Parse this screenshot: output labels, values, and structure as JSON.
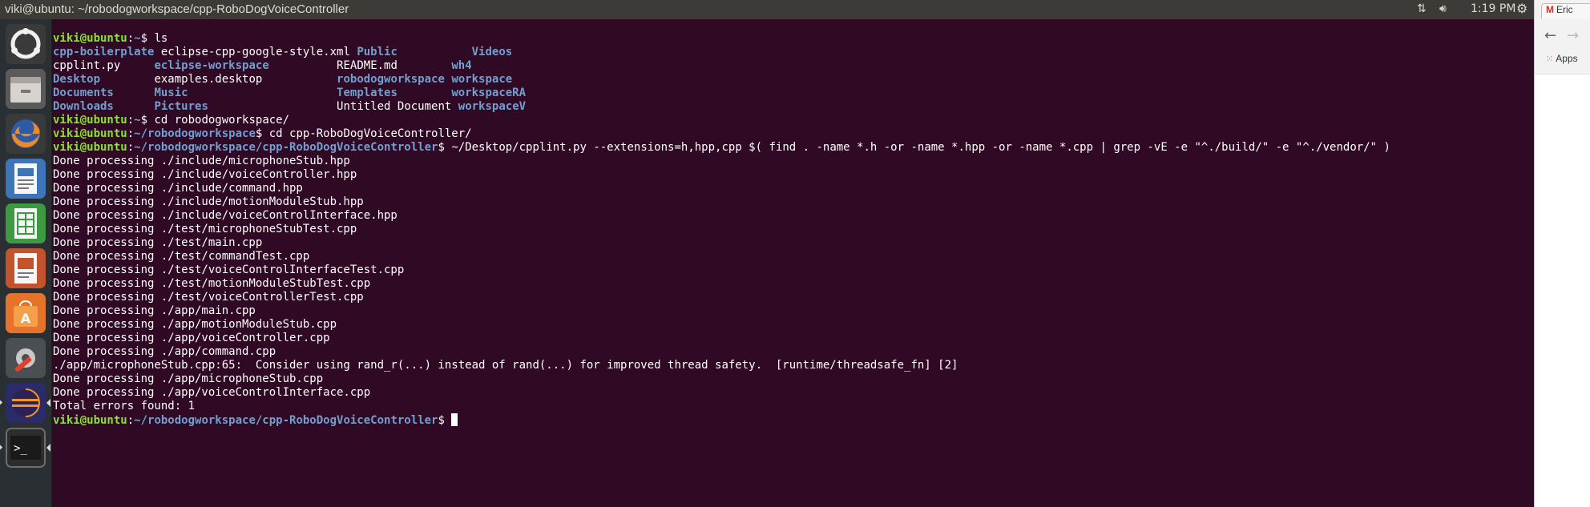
{
  "window": {
    "title": "viki@ubuntu: ~/robodogworkspace/cpp-RoboDogVoiceController"
  },
  "panel": {
    "clock": "1:19 PM"
  },
  "launcher": {
    "icons": [
      "ubuntu-logo-icon",
      "files-icon",
      "firefox-icon",
      "writer-icon",
      "calc-icon",
      "impress-icon",
      "software-center-icon",
      "settings-icon",
      "eclipse-icon",
      "terminal-icon"
    ]
  },
  "browser": {
    "tab_label": "Eric",
    "apps_label": "Apps"
  },
  "terminal": {
    "user_host": "viki@ubuntu",
    "home_path": "~",
    "ws_path": "~/robodogworkspace",
    "proj_path": "~/robodogworkspace/cpp-RoboDogVoiceController",
    "sym": "$ ",
    "cmd_ls": "ls",
    "cmd_cd1": "cd robodogworkspace/",
    "cmd_cd2": "cd cpp-RoboDogVoiceController/",
    "cmd_lint": "~/Desktop/cpplint.py --extensions=h,hpp,cpp $( find . -name *.h -or -name *.hpp -or -name *.cpp | grep -vE -e \"^./build/\" -e \"^./vendor/\" )",
    "ls_rows": [
      [
        "cpp-boilerplate",
        "eclipse-cpp-google-style.xml",
        "Public",
        "Videos"
      ],
      [
        "cpplint.py",
        "eclipse-workspace",
        "README.md",
        "wh4"
      ],
      [
        "Desktop",
        "examples.desktop",
        "robodogworkspace",
        "workspace"
      ],
      [
        "Documents",
        "Music",
        "Templates",
        "workspaceRA"
      ],
      [
        "Downloads",
        "Pictures",
        "Untitled Document",
        "workspaceV"
      ]
    ],
    "output": [
      "Done processing ./include/microphoneStub.hpp",
      "Done processing ./include/voiceController.hpp",
      "Done processing ./include/command.hpp",
      "Done processing ./include/motionModuleStub.hpp",
      "Done processing ./include/voiceControlInterface.hpp",
      "Done processing ./test/microphoneStubTest.cpp",
      "Done processing ./test/main.cpp",
      "Done processing ./test/commandTest.cpp",
      "Done processing ./test/voiceControlInterfaceTest.cpp",
      "Done processing ./test/motionModuleStubTest.cpp",
      "Done processing ./test/voiceControllerTest.cpp",
      "Done processing ./app/main.cpp",
      "Done processing ./app/motionModuleStub.cpp",
      "Done processing ./app/voiceController.cpp",
      "Done processing ./app/command.cpp",
      "./app/microphoneStub.cpp:65:  Consider using rand_r(...) instead of rand(...) for improved thread safety.  [runtime/threadsafe_fn] [2]",
      "Done processing ./app/microphoneStub.cpp",
      "Done processing ./app/voiceControlInterface.cpp",
      "Total errors found: 1"
    ]
  }
}
